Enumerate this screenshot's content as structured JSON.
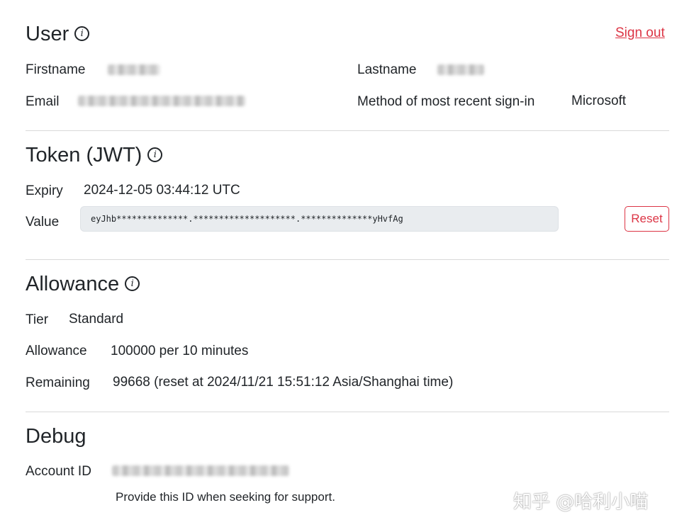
{
  "user": {
    "heading": "User",
    "sign_out": "Sign out",
    "firstname_label": "Firstname",
    "lastname_label": "Lastname",
    "email_label": "Email",
    "method_label": "Method of most recent sign-in",
    "method_value": "Microsoft"
  },
  "token": {
    "heading": "Token (JWT)",
    "expiry_label": "Expiry",
    "expiry_value": "2024-12-05 03:44:12 UTC",
    "value_label": "Value",
    "value": "eyJhb**************.********************.**************yHvfAg",
    "reset_label": "Reset"
  },
  "allowance": {
    "heading": "Allowance",
    "tier_label": "Tier",
    "tier_value": "Standard",
    "allowance_label": "Allowance",
    "allowance_value": "100000 per 10 minutes",
    "remaining_label": "Remaining",
    "remaining_value": "99668 (reset at 2024/11/21 15:51:12 Asia/Shanghai time)"
  },
  "debug": {
    "heading": "Debug",
    "account_id_label": "Account ID",
    "help_text": "Provide this ID when seeking for support."
  },
  "watermark": "知乎 @哈利小喵",
  "icons": {
    "info": "info-circle-icon"
  },
  "colors": {
    "danger": "#dc3545",
    "text": "#212529",
    "token_bg": "#e9ecef",
    "divider": "#d9d9d9"
  }
}
